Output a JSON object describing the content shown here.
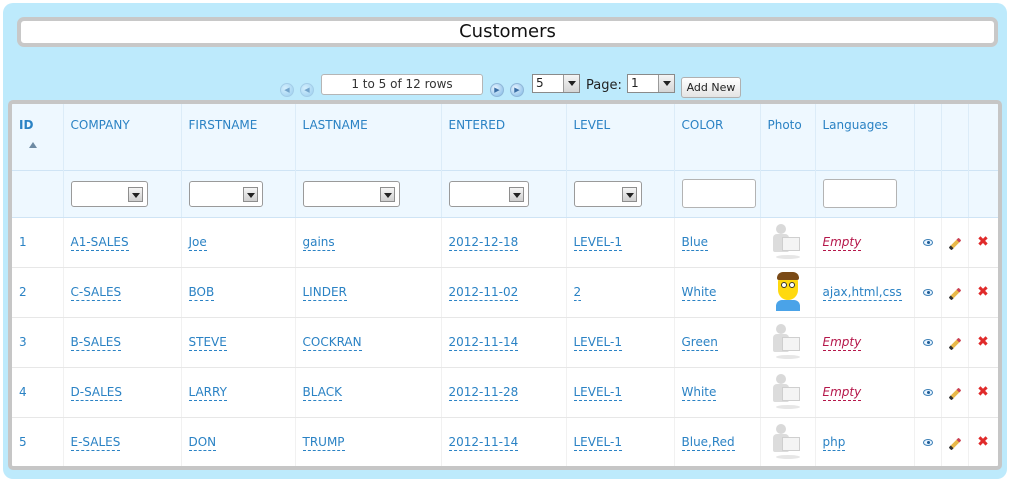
{
  "title": "Customers",
  "pager": {
    "rows_info": "1 to 5 of 12 rows",
    "page_size": "5",
    "page_label": "Page:",
    "page_number": "1",
    "add_button": "Add New"
  },
  "columns": [
    "ID",
    "COMPANY",
    "FIRSTNAME",
    "LASTNAME",
    "ENTERED",
    "LEVEL",
    "COLOR",
    "Photo",
    "Languages"
  ],
  "rows": [
    {
      "id": "1",
      "company": "A1-SALES",
      "firstname": "Joe",
      "lastname": "gains",
      "entered": "2012-12-18",
      "level": "LEVEL-1",
      "color": "Blue",
      "photo": "placeholder",
      "languages": "Empty"
    },
    {
      "id": "2",
      "company": "C-SALES",
      "firstname": "BOB",
      "lastname": "LINDER",
      "entered": "2012-11-02",
      "level": "2",
      "color": "White",
      "photo": "avatar",
      "languages": "ajax,html,css"
    },
    {
      "id": "3",
      "company": "B-SALES",
      "firstname": "STEVE",
      "lastname": "COCKRAN",
      "entered": "2012-11-14",
      "level": "LEVEL-1",
      "color": "Green",
      "photo": "placeholder",
      "languages": "Empty"
    },
    {
      "id": "4",
      "company": "D-SALES",
      "firstname": "LARRY",
      "lastname": "BLACK",
      "entered": "2012-11-28",
      "level": "LEVEL-1",
      "color": "White",
      "photo": "placeholder",
      "languages": "Empty"
    },
    {
      "id": "5",
      "company": "E-SALES",
      "firstname": "DON",
      "lastname": "TRUMP",
      "entered": "2012-11-14",
      "level": "LEVEL-1",
      "color": "Blue,Red",
      "photo": "placeholder",
      "languages": "php"
    }
  ],
  "icons": {
    "first": "first-page-icon",
    "prev": "prev-page-icon",
    "next": "next-page-icon",
    "last": "last-page-icon",
    "view": "eye-icon",
    "edit": "pencil-icon",
    "delete": "delete-x-icon"
  },
  "colors": {
    "frame": "#bdeafc",
    "link": "#2a82c4",
    "empty": "#b5174a",
    "delete": "#e02b2b"
  }
}
